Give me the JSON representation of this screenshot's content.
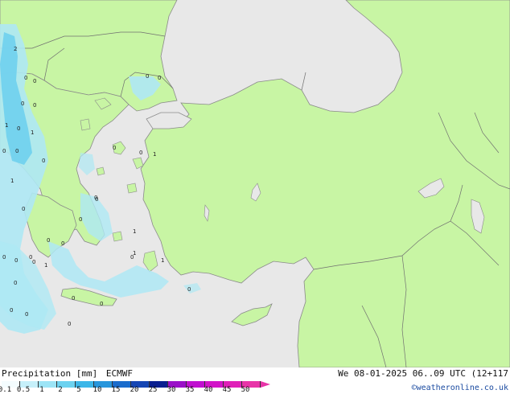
{
  "footer": {
    "title_label": "Precipitation [mm]",
    "model": "ECMWF",
    "datetime": "We 08-01-2025 06..09 UTC (12+117",
    "credit": "©weatheronline.co.uk"
  },
  "colors": {
    "sea": "#e8e8e8",
    "land": "#c8f5a4",
    "coast": "#8a8a8a",
    "border": "#707070",
    "precip_light": "#aee8f4",
    "precip_mid": "#6fd0ee"
  },
  "legend": {
    "ticks": [
      "0.1",
      "0.5",
      "1",
      "2",
      "5",
      "10",
      "15",
      "20",
      "25",
      "30",
      "35",
      "40",
      "45",
      "50"
    ],
    "colors": [
      "#f4fcfe",
      "#c6f0fa",
      "#9ce4f6",
      "#6cd2f0",
      "#3cb6e8",
      "#2896dc",
      "#1a6ccc",
      "#1646b4",
      "#0a1f90",
      "#9a10c8",
      "#c010d0",
      "#d214c8",
      "#e020b8",
      "#e834a8"
    ],
    "arrow_color": "#e834a8"
  },
  "map_labels": [
    {
      "text": "2",
      "id": "a"
    },
    {
      "text": "0",
      "id": "b"
    },
    {
      "text": "0",
      "id": "c"
    },
    {
      "text": "0",
      "id": "d"
    },
    {
      "text": "0",
      "id": "e"
    },
    {
      "text": "1",
      "id": "f"
    },
    {
      "text": "0",
      "id": "g"
    },
    {
      "text": "1",
      "id": "h"
    },
    {
      "text": "0",
      "id": "i"
    },
    {
      "text": "0",
      "id": "j"
    },
    {
      "text": "0",
      "id": "k"
    },
    {
      "text": "1",
      "id": "l"
    },
    {
      "text": "0",
      "id": "m"
    },
    {
      "text": "0",
      "id": "n"
    },
    {
      "text": "0",
      "id": "o"
    },
    {
      "text": "0",
      "id": "p"
    },
    {
      "text": "0",
      "id": "q"
    },
    {
      "text": "0",
      "id": "r"
    },
    {
      "text": "0",
      "id": "s"
    },
    {
      "text": "1",
      "id": "t"
    },
    {
      "text": "0",
      "id": "u"
    },
    {
      "text": "0",
      "id": "v"
    },
    {
      "text": "1",
      "id": "w"
    },
    {
      "text": "0",
      "id": "x"
    },
    {
      "text": "0",
      "id": "y"
    },
    {
      "text": "1",
      "id": "z"
    },
    {
      "text": "0",
      "id": "aa"
    },
    {
      "text": "0",
      "id": "ab"
    },
    {
      "text": "1",
      "id": "ac"
    },
    {
      "text": "0",
      "id": "ad"
    },
    {
      "text": "0",
      "id": "ae"
    },
    {
      "text": "0",
      "id": "af"
    },
    {
      "text": "0",
      "id": "ag"
    },
    {
      "text": "0",
      "id": "ah"
    },
    {
      "text": "0",
      "id": "ai"
    },
    {
      "text": "1",
      "id": "aj"
    },
    {
      "text": "0",
      "id": "ak"
    },
    {
      "text": "0",
      "id": "al"
    },
    {
      "text": "0",
      "id": "am"
    }
  ]
}
